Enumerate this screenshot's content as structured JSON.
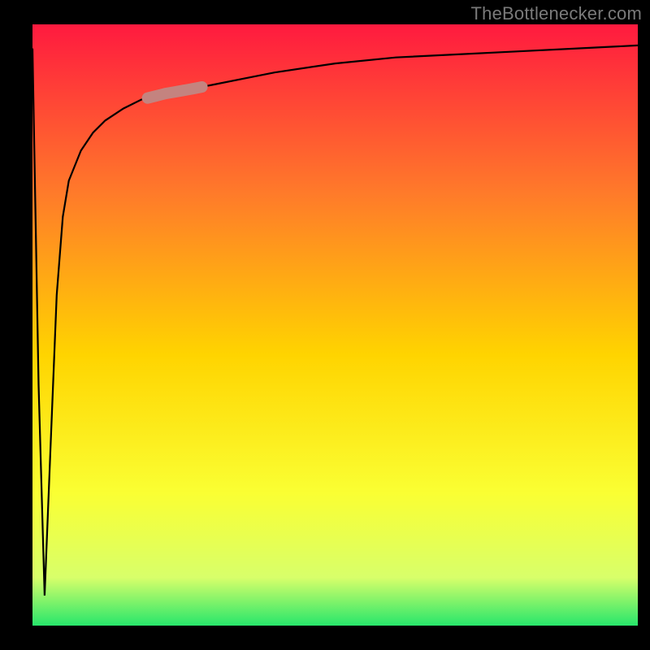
{
  "watermark": "TheBottlenecker.com",
  "chart_data": {
    "type": "line",
    "title": "",
    "xlabel": "",
    "ylabel": "",
    "xlim": [
      0,
      100
    ],
    "ylim": [
      0,
      100
    ],
    "grid": false,
    "legend": false,
    "background_gradient": {
      "top": "#ff1a3f",
      "upper_mid": "#ff7a2a",
      "mid": "#ffd400",
      "lower_mid": "#faff33",
      "near_bottom": "#d8ff6a",
      "bottom": "#27e66b"
    },
    "highlight_segment": {
      "x_range": [
        19,
        28
      ],
      "y_range": [
        84,
        88
      ],
      "color": "#c4837f",
      "note": "thick pale segment overlaid on curve"
    },
    "series": [
      {
        "name": "bottleneck-curve",
        "x": [
          0,
          1,
          2,
          3,
          4,
          5,
          6,
          8,
          10,
          12,
          15,
          18,
          22,
          26,
          30,
          35,
          40,
          50,
          60,
          70,
          80,
          90,
          100
        ],
        "y": [
          96,
          40,
          5,
          30,
          55,
          68,
          74,
          79,
          82,
          84,
          86,
          87.5,
          88.5,
          89.2,
          90,
          91,
          92,
          93.5,
          94.5,
          95,
          95.5,
          96,
          96.5
        ]
      }
    ],
    "notes": "Curve starts near top at x≈0, plunges to near y≈5 at x≈2, then rises logarithmically toward ~y≈96.5 at x=100."
  }
}
